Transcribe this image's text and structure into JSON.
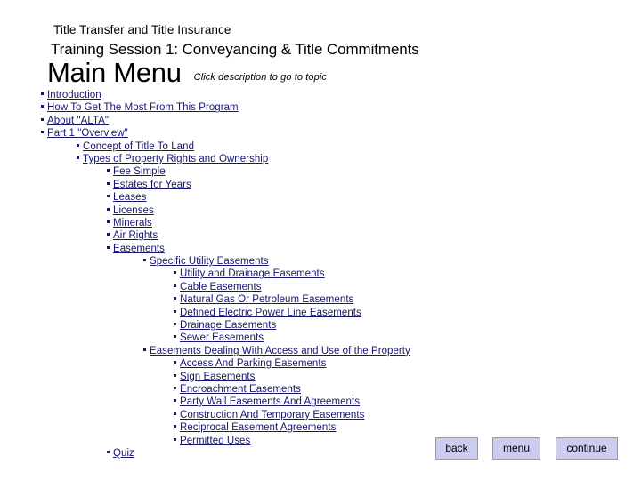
{
  "header": {
    "kicker": "Title Transfer and Title Insurance",
    "subtitle": "Training Session 1: Conveyancing & Title Commitments",
    "title": "Main Menu",
    "hint": "Click description to go to topic"
  },
  "colors": {
    "background": "#ffffff",
    "link": "#16166e",
    "text": "#000000",
    "button_fill": "#ccccf2",
    "button_border": "#9a9a9a"
  },
  "menu": {
    "items": [
      {
        "label": "Introduction",
        "level": 1
      },
      {
        "label": "How To Get The Most From This Program",
        "level": 1
      },
      {
        "label": "About \"ALTA\"",
        "level": 1
      },
      {
        "label": "Part 1 \"Overview\"",
        "level": 1
      },
      {
        "label": "Concept of Title To Land",
        "level": 2
      },
      {
        "label": "Types of Property Rights and Ownership",
        "level": 2
      },
      {
        "label": "Fee Simple",
        "level": 3
      },
      {
        "label": "Estates for Years",
        "level": 3
      },
      {
        "label": "Leases",
        "level": 3
      },
      {
        "label": "Licenses",
        "level": 3
      },
      {
        "label": "Minerals",
        "level": 3
      },
      {
        "label": "Air Rights",
        "level": 3
      },
      {
        "label": "Easements",
        "level": 3
      },
      {
        "label": "Specific Utility Easements",
        "level": 4
      },
      {
        "label": "Utility and Drainage Easements",
        "level": 5
      },
      {
        "label": "Cable Easements",
        "level": 5
      },
      {
        "label": "Natural Gas Or Petroleum Easements",
        "level": 5
      },
      {
        "label": "Defined Electric Power Line Easements",
        "level": 5
      },
      {
        "label": "Drainage Easements",
        "level": 5
      },
      {
        "label": "Sewer Easements",
        "level": 5
      },
      {
        "label": "Easements Dealing With Access and Use of the Property",
        "level": 4
      },
      {
        "label": "Access And Parking Easements",
        "level": 5
      },
      {
        "label": "Sign Easements",
        "level": 5
      },
      {
        "label": "Encroachment Easements",
        "level": 5
      },
      {
        "label": "Party Wall Easements And Agreements",
        "level": 5
      },
      {
        "label": "Construction And Temporary Easements",
        "level": 5
      },
      {
        "label": "Reciprocal Easement Agreements",
        "level": 5
      },
      {
        "label": "Permitted Uses",
        "level": 5
      },
      {
        "label": "Quiz",
        "level": "q"
      }
    ]
  },
  "nav": {
    "back_label": "back",
    "menu_label": "menu",
    "continue_label": "continue"
  }
}
